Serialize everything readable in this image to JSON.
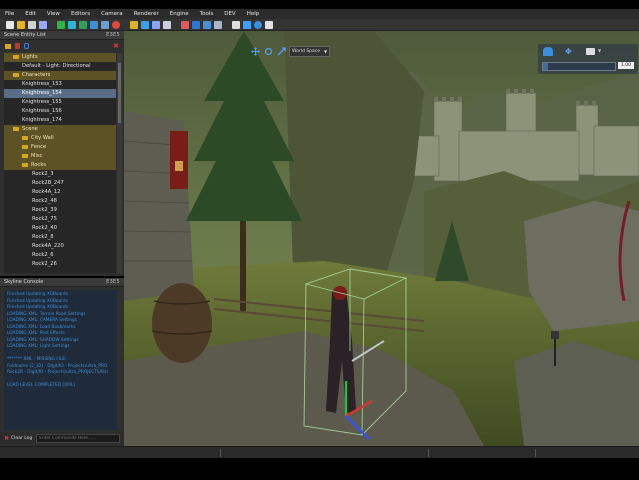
{
  "menu": [
    "File",
    "Edit",
    "View",
    "Editors",
    "Camera",
    "Renderer",
    "Engine",
    "Tools",
    "DEV",
    "Help"
  ],
  "toolbar_icons": [
    "new-icon",
    "open-icon",
    "save-icon",
    "save-as-icon",
    "refresh-icon",
    "undo-icon",
    "redo-icon",
    "select-icon",
    "terrain-icon",
    "record-icon",
    "paint-icon",
    "globe-icon",
    "settings-icon",
    "monitor-icon",
    "graph-icon",
    "export-icon",
    "grid-icon",
    "display-icon",
    "sound-icon",
    "gear-icon",
    "play-icon",
    "gamepad-icon"
  ],
  "entity_panel": {
    "title": "Scene Entity List",
    "tag": "E3E5",
    "items": [
      {
        "label": "Lights",
        "kind": "cat"
      },
      {
        "label": "Default - Light: Directional",
        "kind": "item"
      },
      {
        "label": "Characters",
        "kind": "cat"
      },
      {
        "label": "Knightress_153",
        "kind": "item"
      },
      {
        "label": "Knightress_154",
        "kind": "sel"
      },
      {
        "label": "Knightress_155",
        "kind": "item"
      },
      {
        "label": "Knightress_156",
        "kind": "item"
      },
      {
        "label": "Knightress_174",
        "kind": "item"
      },
      {
        "label": "Scene",
        "kind": "cat"
      },
      {
        "label": "City Wall",
        "kind": "cat"
      },
      {
        "label": "Fence",
        "kind": "cat"
      },
      {
        "label": "Misc",
        "kind": "cat"
      },
      {
        "label": "Rocks",
        "kind": "cat"
      },
      {
        "label": "Rock2_3",
        "kind": "item"
      },
      {
        "label": "Rock2B_247",
        "kind": "item"
      },
      {
        "label": "Rock4A_12",
        "kind": "item"
      },
      {
        "label": "Rock2_48",
        "kind": "item"
      },
      {
        "label": "Rock2_39",
        "kind": "item"
      },
      {
        "label": "Rock2_75",
        "kind": "item"
      },
      {
        "label": "Rock2_40",
        "kind": "item"
      },
      {
        "label": "Rock2_8",
        "kind": "item"
      },
      {
        "label": "Rock4A_220",
        "kind": "item"
      },
      {
        "label": "Rock2_6",
        "kind": "item"
      },
      {
        "label": "Rock2_26",
        "kind": "item"
      }
    ]
  },
  "console": {
    "title": "Skyline Console",
    "tag": "E3E5",
    "lines": [
      "Finished Updating XOBoards",
      "Finished Updating XOBoards",
      "Finished Updating XOBoards",
      "LOADING XML: Terrain Road Settings",
      "LOADING XML: CAMERA Settings",
      "LOADING XML: Load Bookmarks",
      "LOADING XML: Post Effects",
      "LOADING XML: SHADOW Settings",
      "LOADING XML: Light Settings",
      "",
      "******* XML : MISSING FILE:",
      "Foldname (2_32) - Digit/IO - Projects/ultra_PRO",
      "Rock2B - Digit/IO - Projects/ultra_PROJECTS/Bar",
      "",
      "LOAD LEVEL COMPLETED [XML]"
    ],
    "clear_label": "Clear Log",
    "command_placeholder": "Enter Commands Here......"
  },
  "viewport": {
    "space_label": "World Space",
    "cam_value": "1.00",
    "cam_level": 0.07
  },
  "colors": {
    "category_row": "#5c5226",
    "selected_row": "#5a6d86",
    "console_text": "#3d8ed9",
    "folder": "#d9a520"
  }
}
